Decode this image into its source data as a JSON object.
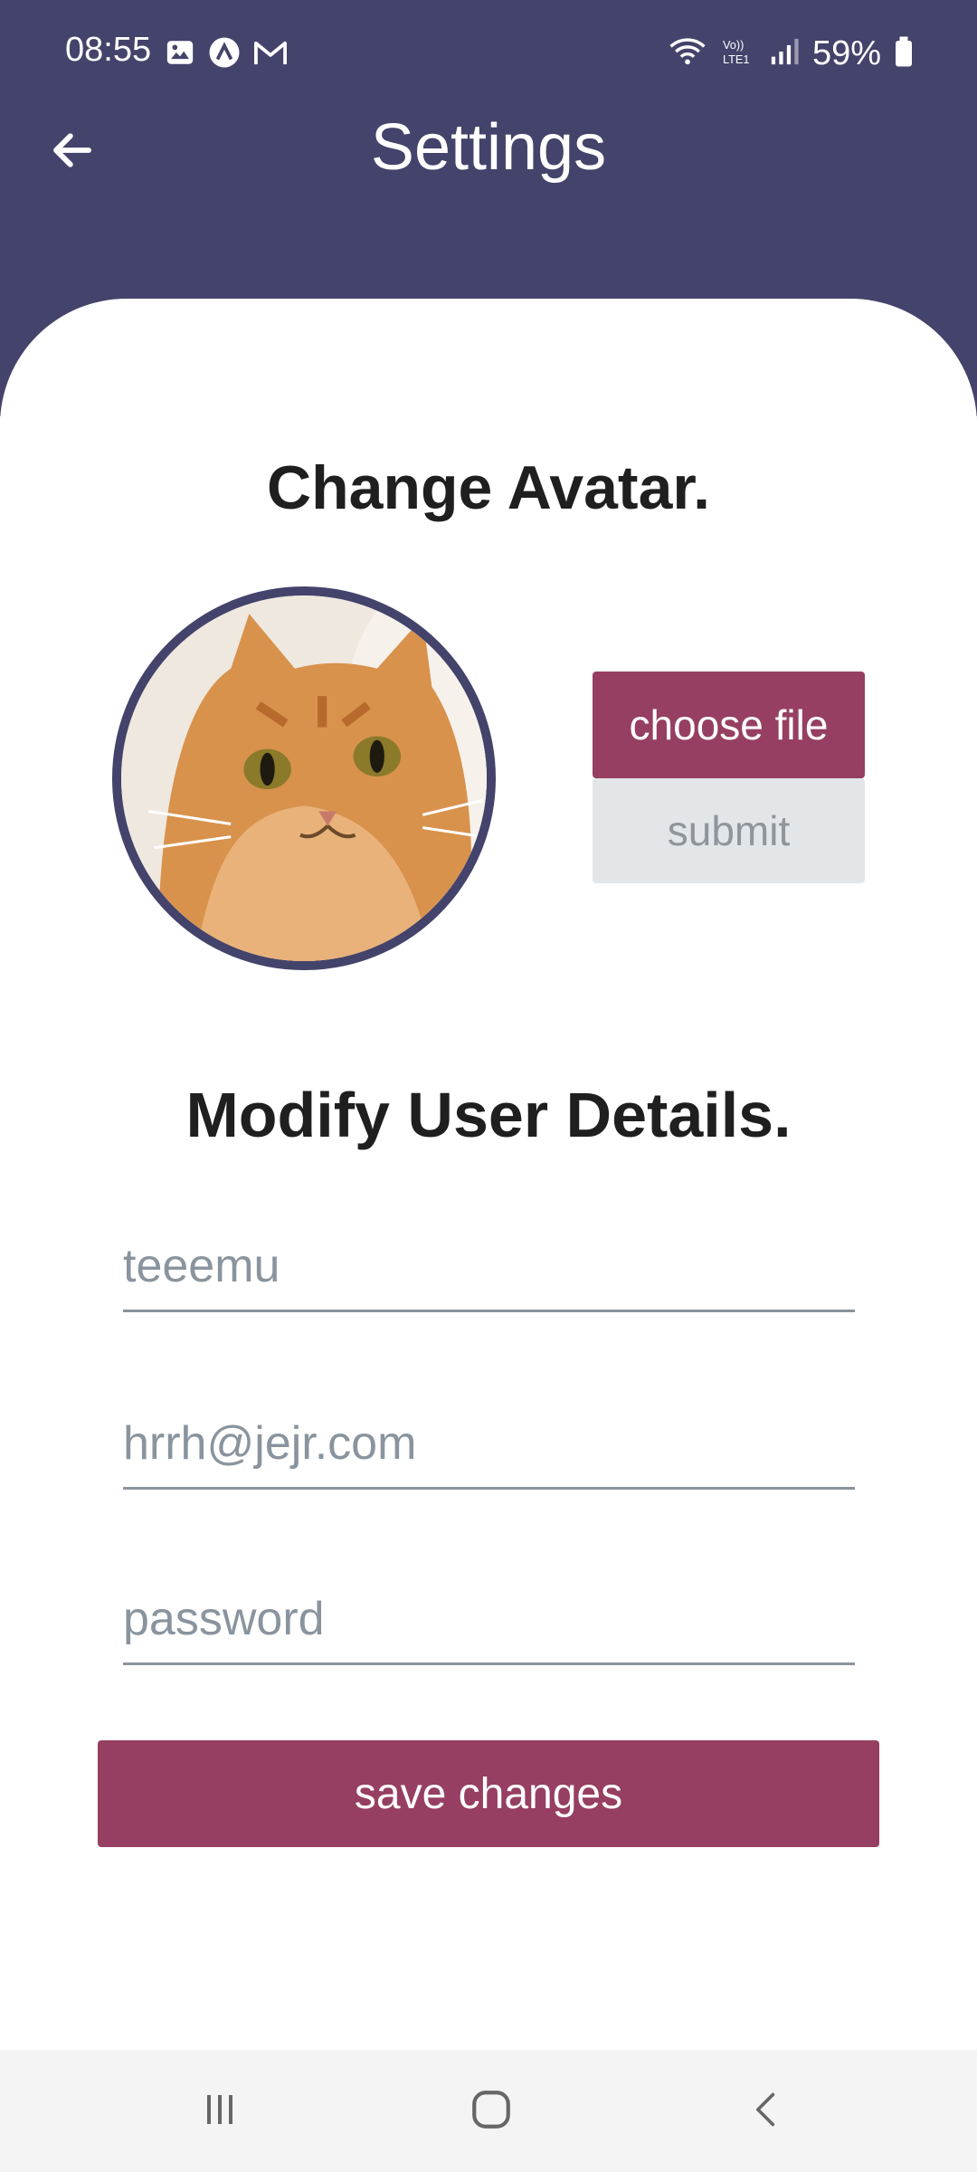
{
  "status_bar": {
    "time": "08:55",
    "battery": "59%",
    "icons_left": [
      "image-icon",
      "app-icon",
      "gmail-icon"
    ],
    "icons_right": [
      "wifi-icon",
      "volte-icon",
      "signal-icon",
      "battery-icon"
    ]
  },
  "header": {
    "title": "Settings",
    "back_icon": "arrow-left-icon"
  },
  "avatar_section": {
    "title": "Change Avatar.",
    "choose_label": "choose file",
    "submit_label": "submit"
  },
  "details_section": {
    "title": "Modify User Details.",
    "username_placeholder": "teeemu",
    "email_placeholder": "hrrh@jejr.com",
    "password_placeholder": "password",
    "save_label": "save changes"
  },
  "nav_bar": {
    "items": [
      "recent-apps-icon",
      "home-icon",
      "back-icon"
    ]
  },
  "colors": {
    "header": "#43436b",
    "accent": "#963f62",
    "disabled_bg": "#e3e6e9",
    "placeholder": "#8a949e"
  }
}
